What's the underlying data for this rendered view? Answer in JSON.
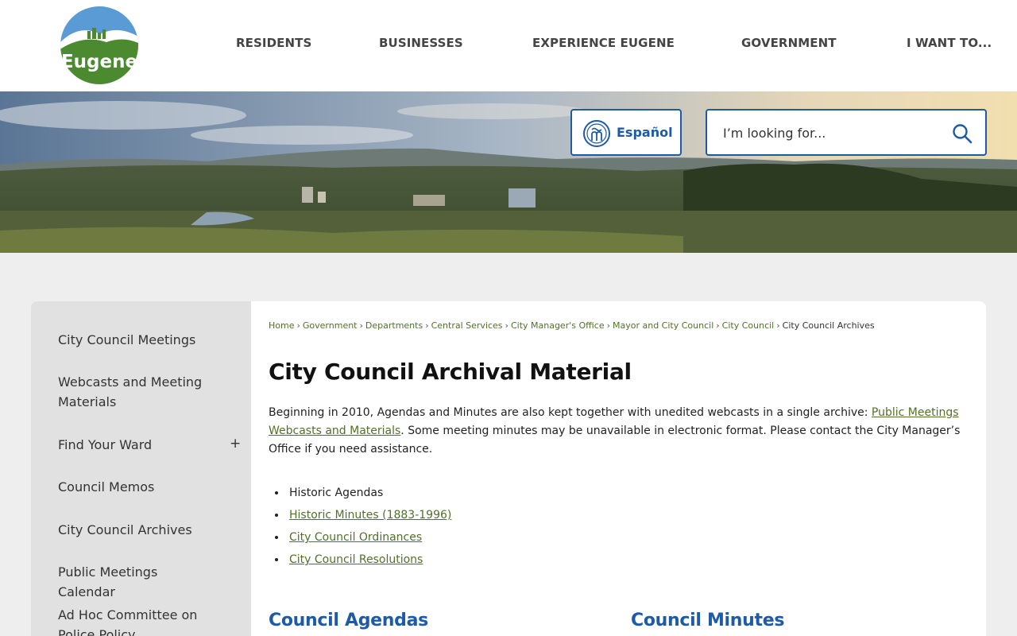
{
  "logo": {
    "text": "Eugene"
  },
  "nav": [
    {
      "label": "RESIDENTS"
    },
    {
      "label": "BUSINESSES"
    },
    {
      "label": "EXPERIENCE EUGENE"
    },
    {
      "label": "GOVERNMENT"
    },
    {
      "label": "I WANT TO..."
    }
  ],
  "language": {
    "label": "Español"
  },
  "search": {
    "placeholder": "I’m looking for..."
  },
  "sidebar": {
    "items": [
      {
        "label": "City Council Meetings"
      },
      {
        "label": "Webcasts and Meeting Materials"
      },
      {
        "label": "Find Your Ward",
        "expand": "+"
      },
      {
        "label": "Council Memos"
      },
      {
        "label": "City Council Archives"
      },
      {
        "label": "Public Meetings Calendar"
      },
      {
        "label": "Ad Hoc Committee on Police Policy"
      }
    ]
  },
  "breadcrumb": [
    {
      "label": "Home"
    },
    {
      "label": "Government"
    },
    {
      "label": "Departments"
    },
    {
      "label": "Central Services"
    },
    {
      "label": "City Manager's Office"
    },
    {
      "label": "Mayor and City Council"
    },
    {
      "label": "City Council"
    },
    {
      "label": "City Council Archives"
    }
  ],
  "breadcrumb_sep": "›",
  "page": {
    "title": "City Council Archival Material",
    "intro_before": "Beginning in 2010, Agendas and Minutes are also kept together with unedited webcasts in a single archive: ",
    "intro_link": "Public Meetings Webcasts and Materials",
    "intro_after": ". Some meeting minutes may be unavailable in electronic format. Please contact the City Manager’s Office if you need assistance."
  },
  "archive_links": [
    {
      "label": "Historic Agendas"
    },
    {
      "label": "Historic Minutes (1883-1996)"
    },
    {
      "label": "City Council Ordinances"
    },
    {
      "label": "City Council Resolutions"
    }
  ],
  "sections": [
    {
      "label": "Council Agendas"
    },
    {
      "label": "Council Minutes"
    }
  ],
  "colors": {
    "brand_blue": "#1d5aa7",
    "link_green": "#507126",
    "logo_green": "#4b8a2e"
  }
}
